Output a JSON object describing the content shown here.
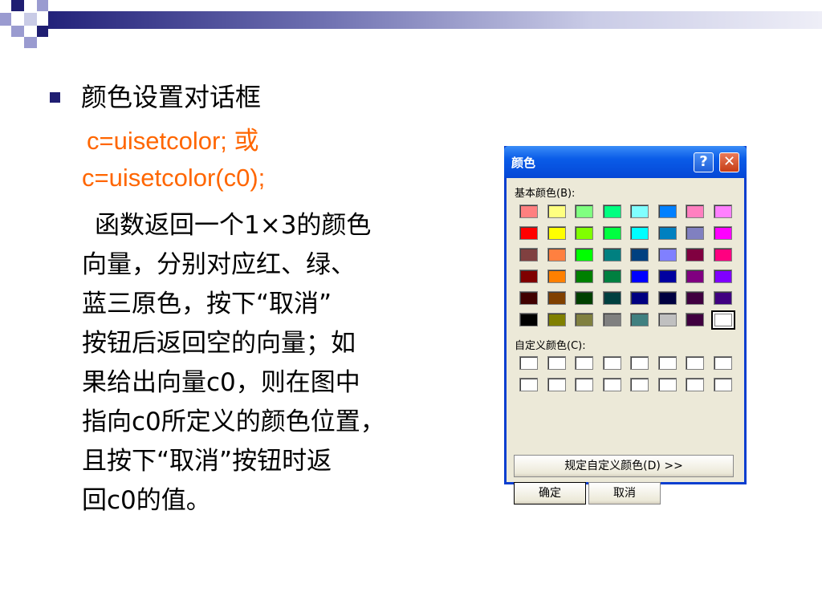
{
  "slide": {
    "bullet_title": "颜色设置对话框",
    "code_lines": [
      "c=uisetcolor; 或",
      "c=uisetcolor(c0);"
    ],
    "paragraph_lines": [
      "函数返回一个1×3的颜色",
      "向量，分别对应红、绿、",
      "蓝三原色，按下“取消”",
      "按钮后返回空的向量；如",
      "果给出向量c0，则在图中",
      "指向c0所定义的颜色位置，",
      "且按下“取消”按钮时返",
      "回c0的值。"
    ]
  },
  "dialog": {
    "title": "颜色",
    "help_label": "?",
    "close_label": "✕",
    "basic_colors_label": "基本颜色(B):",
    "custom_colors_label": "自定义颜色(C):",
    "define_button": "规定自定义颜色(D) >>",
    "ok_button": "确定",
    "cancel_button": "取消",
    "basic_colors": [
      [
        "#ff8080",
        "#ffff80",
        "#80ff80",
        "#00ff80",
        "#80ffff",
        "#0080ff",
        "#ff80c0",
        "#ff80ff"
      ],
      [
        "#ff0000",
        "#ffff00",
        "#80ff00",
        "#00ff40",
        "#00ffff",
        "#0080c0",
        "#8080c0",
        "#ff00ff"
      ],
      [
        "#804040",
        "#ff8040",
        "#00ff00",
        "#008080",
        "#004080",
        "#8080ff",
        "#800040",
        "#ff0080"
      ],
      [
        "#800000",
        "#ff8000",
        "#008000",
        "#008040",
        "#0000ff",
        "#0000a0",
        "#800080",
        "#8000ff"
      ],
      [
        "#400000",
        "#804000",
        "#004000",
        "#004040",
        "#000080",
        "#000040",
        "#400040",
        "#400080"
      ],
      [
        "#000000",
        "#808000",
        "#808040",
        "#808080",
        "#408080",
        "#c0c0c0",
        "#400040",
        "#ffffff"
      ]
    ],
    "selected_color_index": [
      5,
      7
    ]
  }
}
